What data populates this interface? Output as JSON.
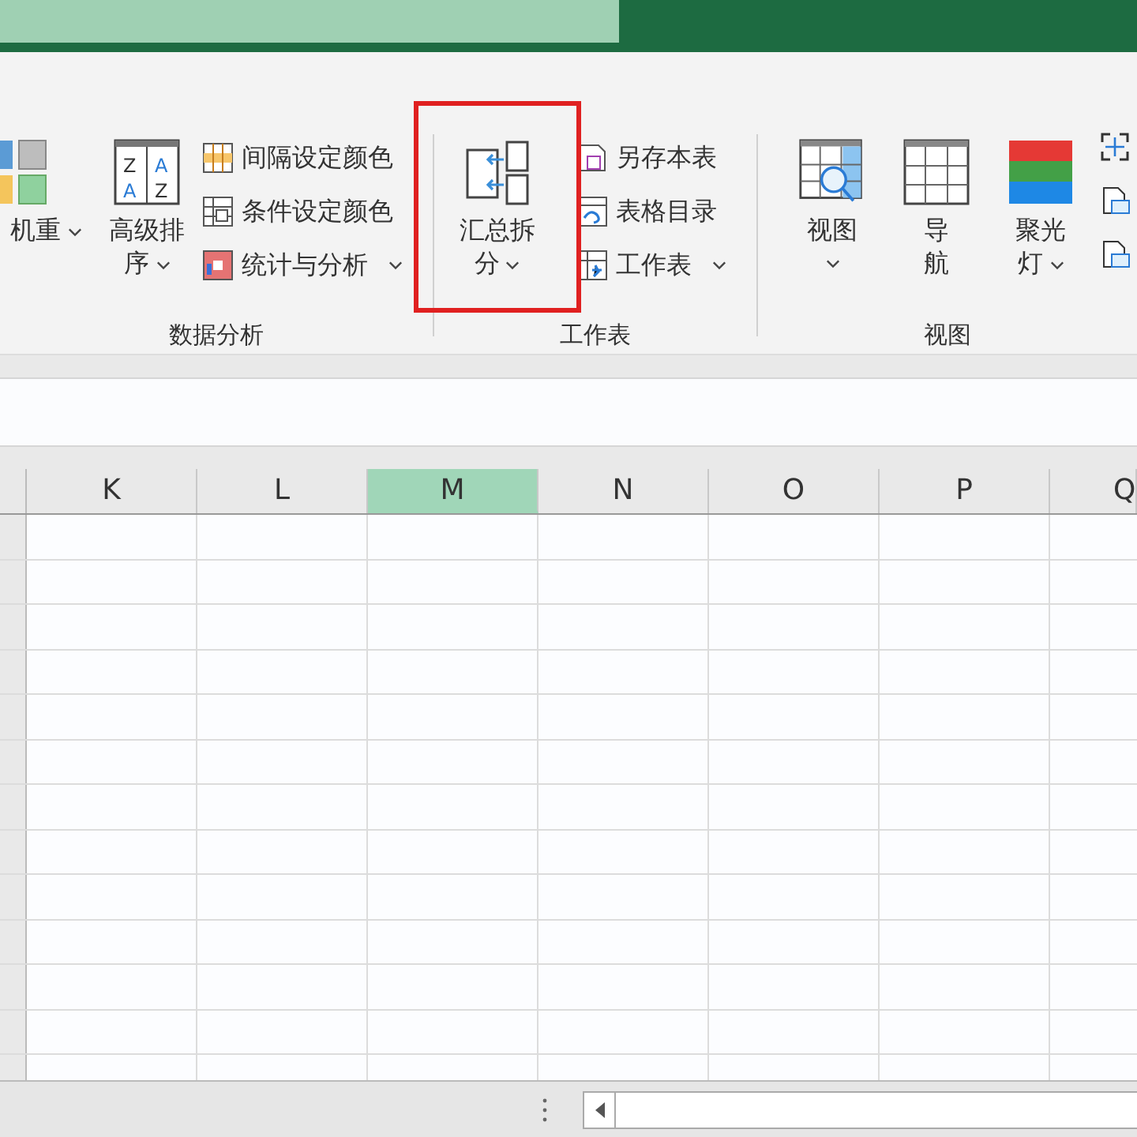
{
  "ribbon": {
    "groups": [
      {
        "label": "数据分析",
        "items": [
          {
            "kind": "large",
            "lines": [
              "机重"
            ],
            "dropdown": true,
            "highlighted": false
          },
          {
            "kind": "large",
            "lines": [
              "高级排",
              "序"
            ],
            "dropdown": true,
            "highlighted": false,
            "icon_letters": [
              "Z",
              "A",
              "A",
              "Z"
            ]
          },
          {
            "kind": "small_stack",
            "entries": [
              {
                "label": "间隔设定颜色",
                "dropdown": false
              },
              {
                "label": "条件设定颜色",
                "dropdown": false
              },
              {
                "label": "统计与分析",
                "dropdown": true
              }
            ]
          }
        ]
      },
      {
        "label": "工作表",
        "items": [
          {
            "kind": "large",
            "lines": [
              "汇总拆",
              "分"
            ],
            "dropdown": true,
            "highlighted": true
          },
          {
            "kind": "small_stack",
            "entries": [
              {
                "label": "另存本表",
                "dropdown": false
              },
              {
                "label": "表格目录",
                "dropdown": false
              },
              {
                "label": "工作表",
                "dropdown": true
              }
            ]
          }
        ]
      },
      {
        "label": "视图",
        "items": [
          {
            "kind": "large",
            "lines": [
              "视图"
            ],
            "dropdown": true,
            "caret_below": true,
            "highlighted": false
          },
          {
            "kind": "large",
            "lines": [
              "导",
              "航"
            ],
            "dropdown": false,
            "highlighted": false
          },
          {
            "kind": "large",
            "lines": [
              "聚光",
              "灯"
            ],
            "dropdown": true,
            "highlighted": false
          },
          {
            "kind": "icon_column"
          }
        ]
      }
    ]
  },
  "columns": [
    {
      "label": "K",
      "selected": false
    },
    {
      "label": "L",
      "selected": false
    },
    {
      "label": "M",
      "selected": true
    },
    {
      "label": "N",
      "selected": false
    },
    {
      "label": "O",
      "selected": false
    },
    {
      "label": "P",
      "selected": false
    },
    {
      "label": "Q",
      "selected": false
    }
  ]
}
